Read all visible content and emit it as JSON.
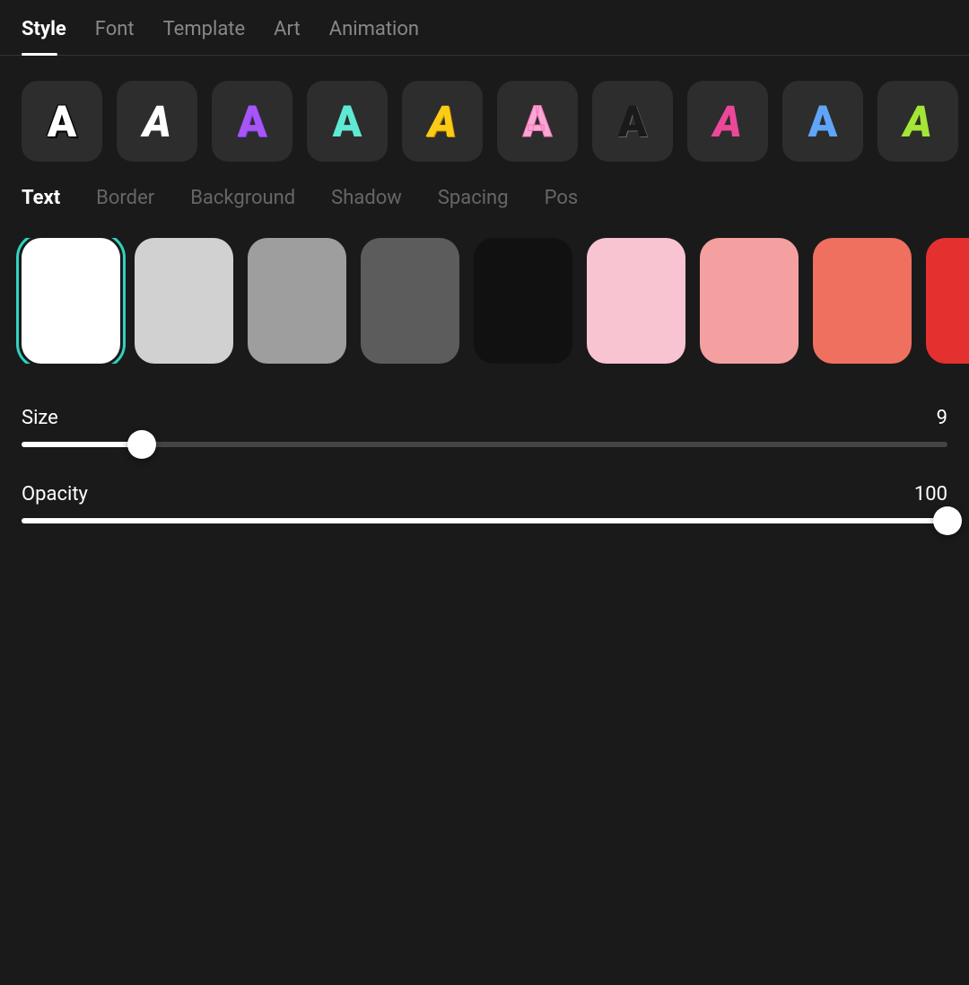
{
  "topNav": {
    "items": [
      {
        "id": "style",
        "label": "Style",
        "active": true
      },
      {
        "id": "font",
        "label": "Font",
        "active": false
      },
      {
        "id": "template",
        "label": "Template",
        "active": false
      },
      {
        "id": "art",
        "label": "Art",
        "active": false
      },
      {
        "id": "animation",
        "label": "Animation",
        "active": false
      }
    ]
  },
  "stylePresets": [
    {
      "id": "preset-1",
      "letter": "A",
      "colorClass": "preset-a-white"
    },
    {
      "id": "preset-2",
      "letter": "A",
      "colorClass": "preset-a-bold"
    },
    {
      "id": "preset-3",
      "letter": "A",
      "colorClass": "preset-a-purple"
    },
    {
      "id": "preset-4",
      "letter": "A",
      "colorClass": "preset-a-teal"
    },
    {
      "id": "preset-5",
      "letter": "A",
      "colorClass": "preset-a-yellow"
    },
    {
      "id": "preset-6",
      "letter": "A",
      "colorClass": "preset-a-pink-outline"
    },
    {
      "id": "preset-7",
      "letter": "A",
      "colorClass": "preset-a-dark"
    },
    {
      "id": "preset-8",
      "letter": "A",
      "colorClass": "preset-a-hot-pink"
    },
    {
      "id": "preset-9",
      "letter": "A",
      "colorClass": "preset-a-blue"
    },
    {
      "id": "preset-10",
      "letter": "A",
      "colorClass": "preset-a-lime"
    }
  ],
  "subNav": {
    "items": [
      {
        "id": "text",
        "label": "Text",
        "active": true
      },
      {
        "id": "border",
        "label": "Border",
        "active": false
      },
      {
        "id": "background",
        "label": "Background",
        "active": false
      },
      {
        "id": "shadow",
        "label": "Shadow",
        "active": false
      },
      {
        "id": "spacing",
        "label": "Spacing",
        "active": false
      },
      {
        "id": "pos",
        "label": "Pos",
        "active": false
      }
    ]
  },
  "colorSwatches": [
    {
      "id": "swatch-white",
      "color": "#ffffff",
      "selected": true
    },
    {
      "id": "swatch-lightgray",
      "color": "#d1d1d1",
      "selected": false
    },
    {
      "id": "swatch-midgray",
      "color": "#9e9e9e",
      "selected": false
    },
    {
      "id": "swatch-darkgray",
      "color": "#5c5c5c",
      "selected": false
    },
    {
      "id": "swatch-black",
      "color": "#111111",
      "selected": false
    },
    {
      "id": "swatch-lightpink",
      "color": "#f9c4d2",
      "selected": false
    },
    {
      "id": "swatch-salmon",
      "color": "#f4a0a0",
      "selected": false
    },
    {
      "id": "swatch-coral",
      "color": "#f07060",
      "selected": false
    },
    {
      "id": "swatch-red",
      "color": "#e53030",
      "selected": false
    }
  ],
  "sizeSlider": {
    "label": "Size",
    "value": 9,
    "min": 0,
    "max": 100,
    "percentage": 13
  },
  "opacitySlider": {
    "label": "Opacity",
    "value": 100,
    "min": 0,
    "max": 100,
    "percentage": 100
  }
}
